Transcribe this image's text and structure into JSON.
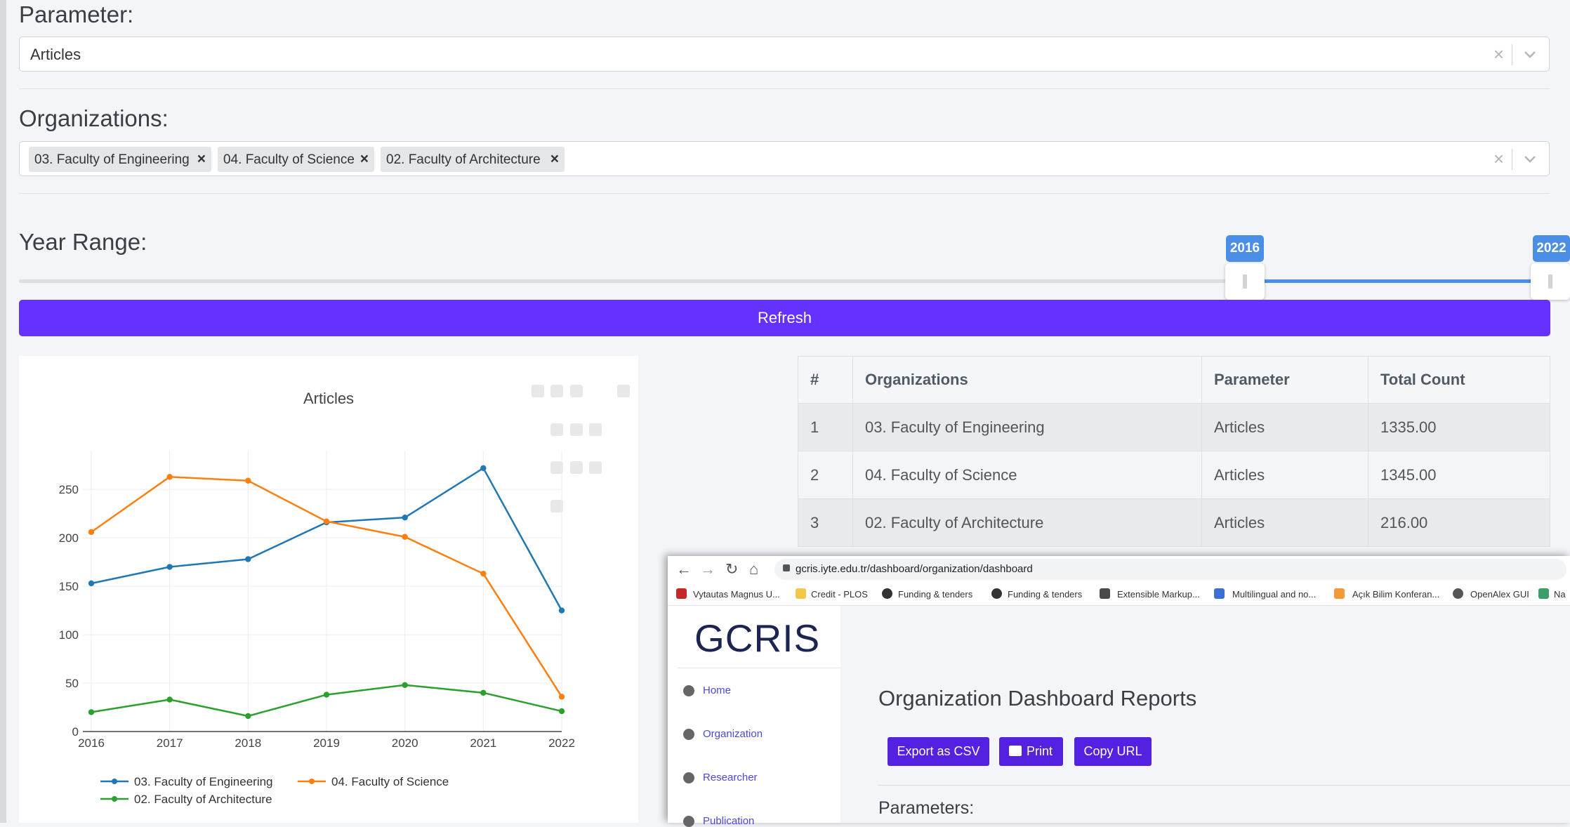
{
  "parameter": {
    "label": "Parameter:",
    "value": "Articles",
    "clear": "×"
  },
  "organizations": {
    "label": "Organizations:",
    "tags": [
      "03. Faculty of Engineering",
      "04. Faculty of Science",
      "02. Faculty of Architecture"
    ],
    "tag_remove": "×",
    "clear": "×"
  },
  "year_range": {
    "label": "Year Range:",
    "min_label": "2016",
    "max_label": "2022",
    "start": 2016,
    "end": 2022
  },
  "refresh_label": "Refresh",
  "chart_data": {
    "type": "line",
    "title": "Articles",
    "x": [
      2016,
      2017,
      2018,
      2019,
      2020,
      2021,
      2022
    ],
    "ylim": [
      0,
      290
    ],
    "yticks": [
      0,
      50,
      100,
      150,
      200,
      250
    ],
    "legend_placement": "bottom",
    "series": [
      {
        "name": "03. Faculty of Engineering",
        "color": "#1f77b4",
        "values": [
          153,
          170,
          178,
          216,
          221,
          272,
          125
        ]
      },
      {
        "name": "04. Faculty of Science",
        "color": "#ff7f0e",
        "values": [
          206,
          263,
          259,
          217,
          201,
          163,
          36
        ]
      },
      {
        "name": "02. Faculty of Architecture",
        "color": "#2ca02c",
        "values": [
          20,
          33,
          16,
          38,
          48,
          40,
          21
        ]
      }
    ]
  },
  "table": {
    "headers": [
      "#",
      "Organizations",
      "Parameter",
      "Total Count"
    ],
    "rows": [
      [
        "1",
        "03. Faculty of Engineering",
        "Articles",
        "1335.00"
      ],
      [
        "2",
        "04. Faculty of Science",
        "Articles",
        "1345.00"
      ],
      [
        "3",
        "02. Faculty of Architecture",
        "Articles",
        "216.00"
      ]
    ]
  },
  "browser": {
    "url": "gcris.iyte.edu.tr/dashboard/organization/dashboard",
    "bookmarks": [
      "Vytautas Magnus U...",
      "Credit - PLOS",
      "Funding & tenders",
      "Funding & tenders",
      "Extensible Markup...",
      "Multilingual and no...",
      "Açık Bilim Konferan...",
      "OpenAlex GUI",
      "Na"
    ]
  },
  "app": {
    "logo": "GCRIS",
    "nav": [
      "Home",
      "Organization",
      "Researcher",
      "Publication"
    ],
    "page_title": "Organization Dashboard Reports",
    "buttons": {
      "export": "Export as CSV",
      "print": "Print",
      "copy": "Copy URL"
    },
    "section_title": "Parameters:"
  }
}
